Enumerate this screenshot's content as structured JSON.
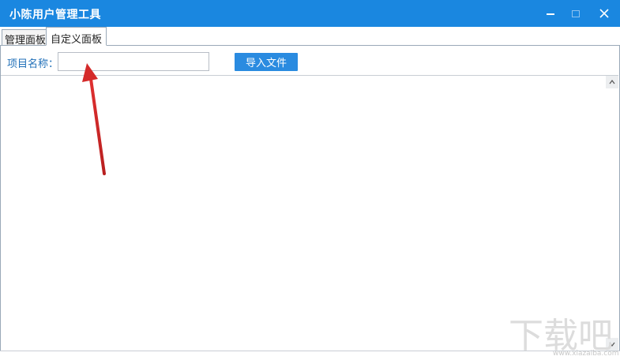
{
  "window": {
    "title": "小陈用户管理工具",
    "controls": {
      "minimize": "minimize",
      "maximize": "maximize",
      "close": "✕"
    }
  },
  "tabs": [
    {
      "label": "管理面板",
      "active": false
    },
    {
      "label": "自定义面板",
      "active": true
    }
  ],
  "form": {
    "project_label": "项目名称：",
    "project_value": "",
    "import_button": "导入文件"
  },
  "scrollbar": {
    "up": "^",
    "down": "v"
  },
  "watermark": {
    "text": "下载吧",
    "url": "www.xiazaiba.com"
  },
  "colors": {
    "titlebar": "#1a87e0",
    "button": "#2a8be0",
    "label": "#1f6fb8",
    "arrow": "#cc2222"
  },
  "icons": [
    "minimize-icon",
    "maximize-icon",
    "close-icon",
    "scroll-up-icon",
    "scroll-down-icon",
    "red-arrow-annotation"
  ]
}
